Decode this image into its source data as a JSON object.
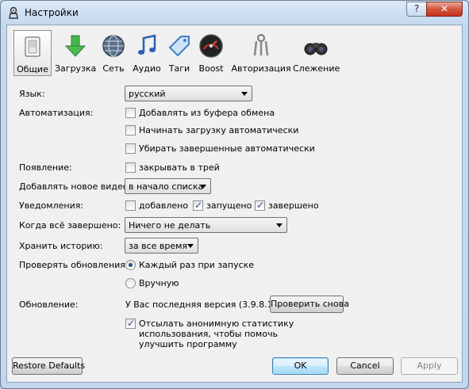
{
  "window": {
    "title": "Настройки",
    "help_label": "?",
    "close_label": "✕",
    "app_icon": "gear-person-icon"
  },
  "toolbar": {
    "items": [
      {
        "label": "Общие",
        "icon": "switch-icon"
      },
      {
        "label": "Загрузка",
        "icon": "download-arrow-icon"
      },
      {
        "label": "Сеть",
        "icon": "globe-icon"
      },
      {
        "label": "Аудио",
        "icon": "music-note-icon"
      },
      {
        "label": "Таги",
        "icon": "tag-icon"
      },
      {
        "label": "Boost",
        "icon": "speedometer-icon"
      },
      {
        "label": "Авторизация",
        "icon": "keys-icon"
      },
      {
        "label": "Слежение",
        "icon": "binoculars-icon"
      }
    ],
    "active_index": 0
  },
  "form": {
    "language": {
      "label": "Язык:",
      "value": "русский"
    },
    "automation": {
      "label": "Автоматизация:",
      "options": [
        {
          "label": "Добавлять из буфера обмена",
          "checked": false
        },
        {
          "label": "Начинать загрузку автоматически",
          "checked": false
        },
        {
          "label": "Убирать завершенные автоматически",
          "checked": false
        }
      ]
    },
    "appearance": {
      "label": "Появление:",
      "option": {
        "label": "закрывать в трей",
        "checked": false
      }
    },
    "add_video": {
      "label": "Добавлять новое видео:",
      "value": "в начало списка"
    },
    "notifications": {
      "label": "Уведомления:",
      "options": [
        {
          "label": "добавлено",
          "checked": false
        },
        {
          "label": "запущено",
          "checked": true
        },
        {
          "label": "завершено",
          "checked": true
        }
      ]
    },
    "when_done": {
      "label": "Когда всё завершено:",
      "value": "Ничего не делать"
    },
    "history": {
      "label": "Хранить историю:",
      "value": "за все время"
    },
    "check_updates": {
      "label": "Проверять обновления:",
      "options": [
        {
          "label": "Каждый раз при запуске",
          "selected": true
        },
        {
          "label": "Вручную",
          "selected": false
        }
      ]
    },
    "update": {
      "label": "Обновление:",
      "status": "У Вас последняя версия (3.9.8.16)",
      "check_button": "Проверить снова"
    },
    "stats": {
      "checked": true,
      "lines": [
        "Отсылать анонимную статистику",
        "использования, чтобы помочь",
        "улучшить программу"
      ]
    }
  },
  "buttons": {
    "restore": "Restore Defaults",
    "ok": "OK",
    "cancel": "Cancel",
    "apply": "Apply"
  }
}
